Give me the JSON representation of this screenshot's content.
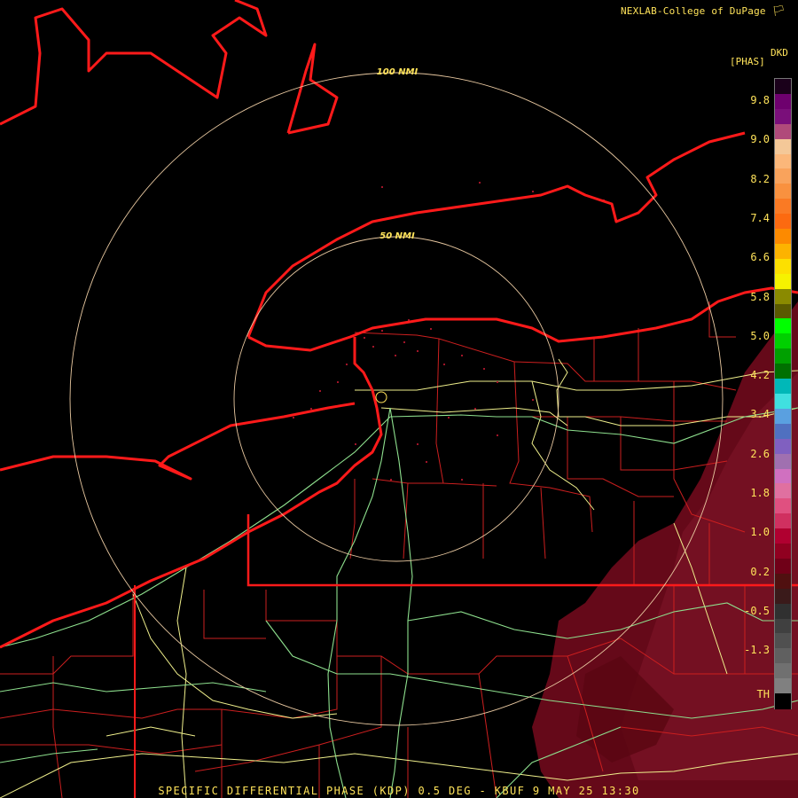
{
  "header": {
    "credit": "NEXLAB-College of DuPage"
  },
  "rings": {
    "inner_label": "50 NMI",
    "outer_label": "100 NMI"
  },
  "legend": {
    "product_code": "DKD",
    "unit": "[PHAS]",
    "ticks": [
      "9.8",
      "9.0",
      "8.2",
      "7.4",
      "6.6",
      "5.8",
      "5.0",
      "4.2",
      "3.4",
      "2.6",
      "1.8",
      "1.0",
      "0.2",
      "-0.5",
      "-1.3",
      "TH"
    ],
    "colors": [
      "#1a001a",
      "#6e006e",
      "#7a0f7a",
      "#b04a7a",
      "#f4c898",
      "#fbb77a",
      "#f9a35c",
      "#f9913f",
      "#fa7a24",
      "#fc6a10",
      "#fd8a00",
      "#fdb300",
      "#fde000",
      "#f6f200",
      "#8a8a00",
      "#5a5a00",
      "#00ff00",
      "#00d000",
      "#00a000",
      "#007000",
      "#00b8b8",
      "#40e0e0",
      "#5aa0e0",
      "#5070c0",
      "#8060c0",
      "#a070b0",
      "#d070c0",
      "#e070a0",
      "#e05080",
      "#d03060",
      "#b00030",
      "#900020",
      "#700018",
      "#501010",
      "#3a1a1a",
      "#303030",
      "#404040",
      "#505050",
      "#606060",
      "#707070",
      "#808080",
      "#000000"
    ]
  },
  "caption": "SPECIFIC DIFFERENTIAL PHASE (KDP) 0.5 DEG - KBUF 9 MAY 25 13:30",
  "colors": {
    "coast": "#ff1a1a",
    "roads": "#f0f08c",
    "highways": "#8ee08e",
    "counties": "#cc1f1f",
    "rings": "#e8c8a0",
    "label": "#ffe35a",
    "echo": "#6a0a1a"
  }
}
